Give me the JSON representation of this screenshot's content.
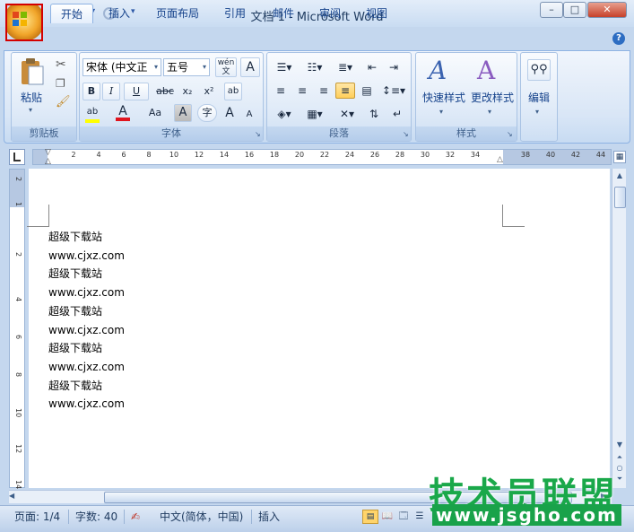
{
  "window": {
    "title": "文档 1 - Microsoft Word",
    "minimize": "–",
    "maximize": "□",
    "close": "✕"
  },
  "tabs": [
    "开始",
    "插入",
    "页面布局",
    "引用",
    "邮件",
    "审阅",
    "视图"
  ],
  "ribbon": {
    "clipboard": {
      "label": "剪贴板",
      "paste": "粘贴"
    },
    "font": {
      "label": "字体",
      "family": "宋体 (中文正",
      "size": "五号",
      "bold": "B",
      "italic": "I",
      "underline": "U",
      "strike": "abc",
      "subscript": "x₂",
      "superscript": "x²",
      "case": "Aa",
      "grow": "A",
      "shrink": "A",
      "clear": "A",
      "wen": "wén 文",
      "border_a": "A",
      "circle_char": "字"
    },
    "paragraph": {
      "label": "段落"
    },
    "styles": {
      "label": "样式",
      "quick": "快速样式",
      "change": "更改样式"
    },
    "editing": {
      "label": "编辑"
    }
  },
  "ruler": {
    "h_ticks": [
      "2",
      "4",
      "6",
      "8",
      "10",
      "12",
      "14",
      "16",
      "18",
      "20",
      "22",
      "24",
      "26",
      "28",
      "30",
      "32",
      "34",
      "38",
      "40",
      "42",
      "44"
    ],
    "v_ticks": [
      "2",
      "1",
      "2",
      "4",
      "6",
      "8",
      "10",
      "12",
      "14"
    ]
  },
  "document": {
    "lines": [
      "超级下载站",
      "www.cjxz.com",
      "超级下载站",
      "www.cjxz.com",
      "超级下载站",
      "www.cjxz.com",
      "超级下载站",
      "www.cjxz.com",
      "超级下载站",
      "www.cjxz.com"
    ]
  },
  "statusbar": {
    "page": "页面: 1/4",
    "words": "字数: 40",
    "language": "中文(简体，中国)",
    "mode": "插入"
  },
  "watermark": {
    "line1": "技术员联盟",
    "line2": "www.jsgho.com"
  },
  "colors": {
    "highlight_office_button": "#d40000",
    "font_color_bar": "#e0141e",
    "highlight_color_bar": "#ffff00",
    "watermark_green": "#1aa84a"
  }
}
